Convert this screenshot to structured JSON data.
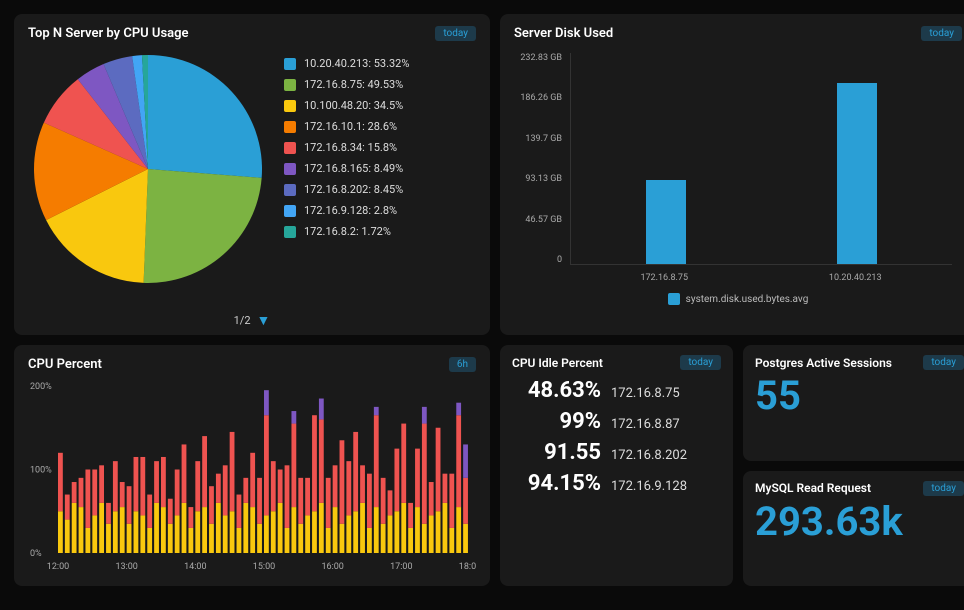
{
  "panels": {
    "pie": {
      "title": "Top N Server by CPU Usage",
      "time": "today",
      "pager": "1/2"
    },
    "disk": {
      "title": "Server Disk Used",
      "time": "today",
      "legend": "system.disk.used.bytes.avg"
    },
    "cpu": {
      "title": "CPU Percent",
      "time": "6h"
    },
    "postgres": {
      "title": "Postgres Active Sessions",
      "time": "today",
      "value": "55"
    },
    "mysql": {
      "title": "MySQL Read Request",
      "time": "today",
      "value": "293.63k"
    },
    "idle": {
      "title": "CPU Idle Percent",
      "time": "today",
      "rows": [
        {
          "pct": "48.63%",
          "host": "172.16.8.75"
        },
        {
          "pct": "99%",
          "host": "172.16.8.87"
        },
        {
          "pct": "91.55",
          "host": "172.16.8.202"
        },
        {
          "pct": "94.15%",
          "host": "172.16.9.128"
        }
      ]
    }
  },
  "chart_data": [
    {
      "id": "pie",
      "type": "pie",
      "title": "Top N Server by CPU Usage",
      "series": [
        {
          "name": "10.20.40.213",
          "value": 53.32,
          "label": "10.20.40.213: 53.32%",
          "color": "#2a9fd6"
        },
        {
          "name": "172.16.8.75",
          "value": 49.53,
          "label": "172.16.8.75: 49.53%",
          "color": "#7cb342"
        },
        {
          "name": "10.100.48.20",
          "value": 34.5,
          "label": "10.100.48.20: 34.5%",
          "color": "#f9c80e"
        },
        {
          "name": "172.16.10.1",
          "value": 28.6,
          "label": "172.16.10.1: 28.6%",
          "color": "#f57c00"
        },
        {
          "name": "172.16.8.34",
          "value": 15.8,
          "label": "172.16.8.34: 15.8%",
          "color": "#ef5350"
        },
        {
          "name": "172.16.8.165",
          "value": 8.49,
          "label": "172.16.8.165: 8.49%",
          "color": "#7e57c2"
        },
        {
          "name": "172.16.8.202",
          "value": 8.45,
          "label": "172.16.8.202: 8.45%",
          "color": "#5c6bc0"
        },
        {
          "name": "172.16.9.128",
          "value": 2.8,
          "label": "172.16.9.128: 2.8%",
          "color": "#42a5f5"
        },
        {
          "name": "172.16.8.2",
          "value": 1.72,
          "label": "172.16.8.2: 1.72%",
          "color": "#26a69a"
        }
      ]
    },
    {
      "id": "disk",
      "type": "bar",
      "title": "Server Disk Used",
      "ylabel": "",
      "xlabel": "",
      "ylim": [
        0,
        232.83
      ],
      "yticks": [
        "232.83 GB",
        "186.26 GB",
        "139.7 GB",
        "93.13 GB",
        "46.57 GB",
        "0"
      ],
      "categories": [
        "172.16.8.75",
        "10.20.40.213"
      ],
      "values": [
        93,
        200
      ],
      "color": "#2a9fd6",
      "legend": "system.disk.used.bytes.avg"
    },
    {
      "id": "cpu",
      "type": "bar",
      "subtype": "stacked",
      "title": "CPU Percent",
      "ylim": [
        0,
        200
      ],
      "yticks": [
        "200%",
        "100%",
        "0%"
      ],
      "x": [
        "12:00",
        "13:00",
        "14:00",
        "15:00",
        "16:00",
        "17:00",
        "18:00"
      ],
      "points_per_tick": 10,
      "colors": {
        "base": "#f9c80e",
        "mid": "#ef5350",
        "top": "#7e57c2"
      },
      "series": [
        {
          "base": 50,
          "mid": 70,
          "top": 0
        },
        {
          "base": 40,
          "mid": 30,
          "top": 0
        },
        {
          "base": 60,
          "mid": 25,
          "top": 0
        },
        {
          "base": 55,
          "mid": 35,
          "top": 0
        },
        {
          "base": 30,
          "mid": 70,
          "top": 0
        },
        {
          "base": 45,
          "mid": 55,
          "top": 0
        },
        {
          "base": 60,
          "mid": 45,
          "top": 0
        },
        {
          "base": 35,
          "mid": 25,
          "top": 0
        },
        {
          "base": 50,
          "mid": 60,
          "top": 0
        },
        {
          "base": 55,
          "mid": 30,
          "top": 0
        },
        {
          "base": 35,
          "mid": 45,
          "top": 0
        },
        {
          "base": 50,
          "mid": 65,
          "top": 0
        },
        {
          "base": 45,
          "mid": 70,
          "top": 0
        },
        {
          "base": 30,
          "mid": 40,
          "top": 0
        },
        {
          "base": 60,
          "mid": 50,
          "top": 0
        },
        {
          "base": 55,
          "mid": 60,
          "top": 0
        },
        {
          "base": 35,
          "mid": 30,
          "top": 0
        },
        {
          "base": 45,
          "mid": 55,
          "top": 0
        },
        {
          "base": 60,
          "mid": 70,
          "top": 0
        },
        {
          "base": 30,
          "mid": 25,
          "top": 0
        },
        {
          "base": 50,
          "mid": 60,
          "top": 0
        },
        {
          "base": 55,
          "mid": 85,
          "top": 0
        },
        {
          "base": 35,
          "mid": 45,
          "top": 0
        },
        {
          "base": 60,
          "mid": 35,
          "top": 0
        },
        {
          "base": 45,
          "mid": 60,
          "top": 0
        },
        {
          "base": 50,
          "mid": 95,
          "top": 0
        },
        {
          "base": 30,
          "mid": 40,
          "top": 0
        },
        {
          "base": 60,
          "mid": 30,
          "top": 0
        },
        {
          "base": 55,
          "mid": 65,
          "top": 0
        },
        {
          "base": 35,
          "mid": 55,
          "top": 0
        },
        {
          "base": 45,
          "mid": 120,
          "top": 30
        },
        {
          "base": 50,
          "mid": 60,
          "top": 0
        },
        {
          "base": 60,
          "mid": 40,
          "top": 0
        },
        {
          "base": 30,
          "mid": 75,
          "top": 0
        },
        {
          "base": 55,
          "mid": 100,
          "top": 15
        },
        {
          "base": 35,
          "mid": 55,
          "top": 0
        },
        {
          "base": 45,
          "mid": 45,
          "top": 0
        },
        {
          "base": 50,
          "mid": 115,
          "top": 0
        },
        {
          "base": 60,
          "mid": 100,
          "top": 25
        },
        {
          "base": 30,
          "mid": 60,
          "top": 0
        },
        {
          "base": 55,
          "mid": 50,
          "top": 0
        },
        {
          "base": 35,
          "mid": 100,
          "top": 0
        },
        {
          "base": 45,
          "mid": 65,
          "top": 0
        },
        {
          "base": 50,
          "mid": 95,
          "top": 0
        },
        {
          "base": 60,
          "mid": 45,
          "top": 0
        },
        {
          "base": 30,
          "mid": 65,
          "top": 0
        },
        {
          "base": 55,
          "mid": 110,
          "top": 10
        },
        {
          "base": 35,
          "mid": 55,
          "top": 0
        },
        {
          "base": 45,
          "mid": 30,
          "top": 0
        },
        {
          "base": 50,
          "mid": 75,
          "top": 0
        },
        {
          "base": 60,
          "mid": 95,
          "top": 0
        },
        {
          "base": 30,
          "mid": 30,
          "top": 0
        },
        {
          "base": 55,
          "mid": 70,
          "top": 0
        },
        {
          "base": 35,
          "mid": 120,
          "top": 20
        },
        {
          "base": 45,
          "mid": 40,
          "top": 0
        },
        {
          "base": 50,
          "mid": 100,
          "top": 0
        },
        {
          "base": 60,
          "mid": 35,
          "top": 0
        },
        {
          "base": 30,
          "mid": 65,
          "top": 0
        },
        {
          "base": 55,
          "mid": 110,
          "top": 15
        },
        {
          "base": 35,
          "mid": 55,
          "top": 40
        }
      ]
    }
  ]
}
